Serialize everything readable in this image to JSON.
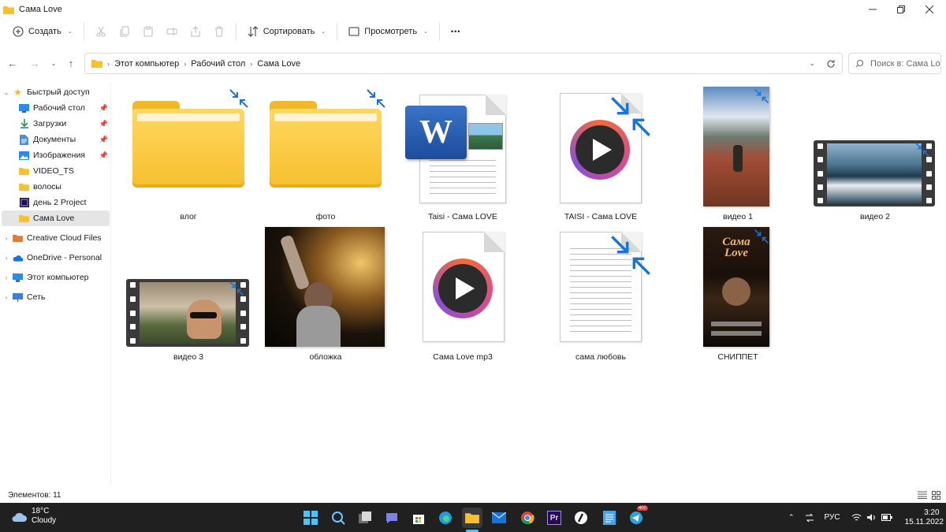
{
  "window": {
    "title": "Сама Love"
  },
  "toolbar": {
    "create_label": "Создать",
    "sort_label": "Сортировать",
    "view_label": "Просмотреть",
    "more_label": "•••"
  },
  "address": {
    "crumbs": [
      "Этот компьютер",
      "Рабочий стол",
      "Сама Love"
    ],
    "search_placeholder": "Поиск в: Сама Love"
  },
  "sidebar": {
    "quick_access": "Быстрый доступ",
    "items": [
      {
        "label": "Рабочий стол",
        "icon": "desktop-icon",
        "pinned": true
      },
      {
        "label": "Загрузки",
        "icon": "download-icon",
        "pinned": true
      },
      {
        "label": "Документы",
        "icon": "documents-icon",
        "pinned": true
      },
      {
        "label": "Изображения",
        "icon": "pictures-icon",
        "pinned": true
      },
      {
        "label": "VIDEO_TS",
        "icon": "folder-icon",
        "pinned": false
      },
      {
        "label": "волосы",
        "icon": "folder-icon",
        "pinned": false
      },
      {
        "label": "день 2 Project",
        "icon": "premiere-project-icon",
        "pinned": false
      },
      {
        "label": "Сама Love",
        "icon": "folder-icon",
        "pinned": false,
        "selected": true
      }
    ],
    "roots": [
      {
        "label": "Creative Cloud Files",
        "icon": "creative-cloud-icon"
      },
      {
        "label": "OneDrive - Personal",
        "icon": "onedrive-icon"
      },
      {
        "label": "Этот компьютер",
        "icon": "computer-icon"
      },
      {
        "label": "Сеть",
        "icon": "network-icon"
      }
    ]
  },
  "files": [
    {
      "name": "влог",
      "type": "folder"
    },
    {
      "name": "фото",
      "type": "folder"
    },
    {
      "name": "Taisi - Сама LOVE",
      "type": "word"
    },
    {
      "name": "TAISI - Сама LOVE",
      "type": "media"
    },
    {
      "name": "видео 1",
      "type": "video-portrait"
    },
    {
      "name": "видео 2",
      "type": "video-landscape"
    },
    {
      "name": "видео 3",
      "type": "video-landscape"
    },
    {
      "name": "обложка",
      "type": "image"
    },
    {
      "name": "Сама Love mp3",
      "type": "media"
    },
    {
      "name": "сама любовь",
      "type": "text"
    },
    {
      "name": "СНИППЕТ",
      "type": "image-portrait"
    }
  ],
  "status": {
    "items_count": "Элементов: 11"
  },
  "taskbar": {
    "temperature": "18°C",
    "weather": "Cloudy",
    "language": "РУС",
    "time": "3:20",
    "date": "15.11.2022",
    "telegram_badge": "400"
  },
  "colors": {
    "accent": "#1a73d6",
    "folder_yellow": "#f6c02e",
    "taskbar_bg": "#202020",
    "selected_bg": "#e5e5e5"
  }
}
